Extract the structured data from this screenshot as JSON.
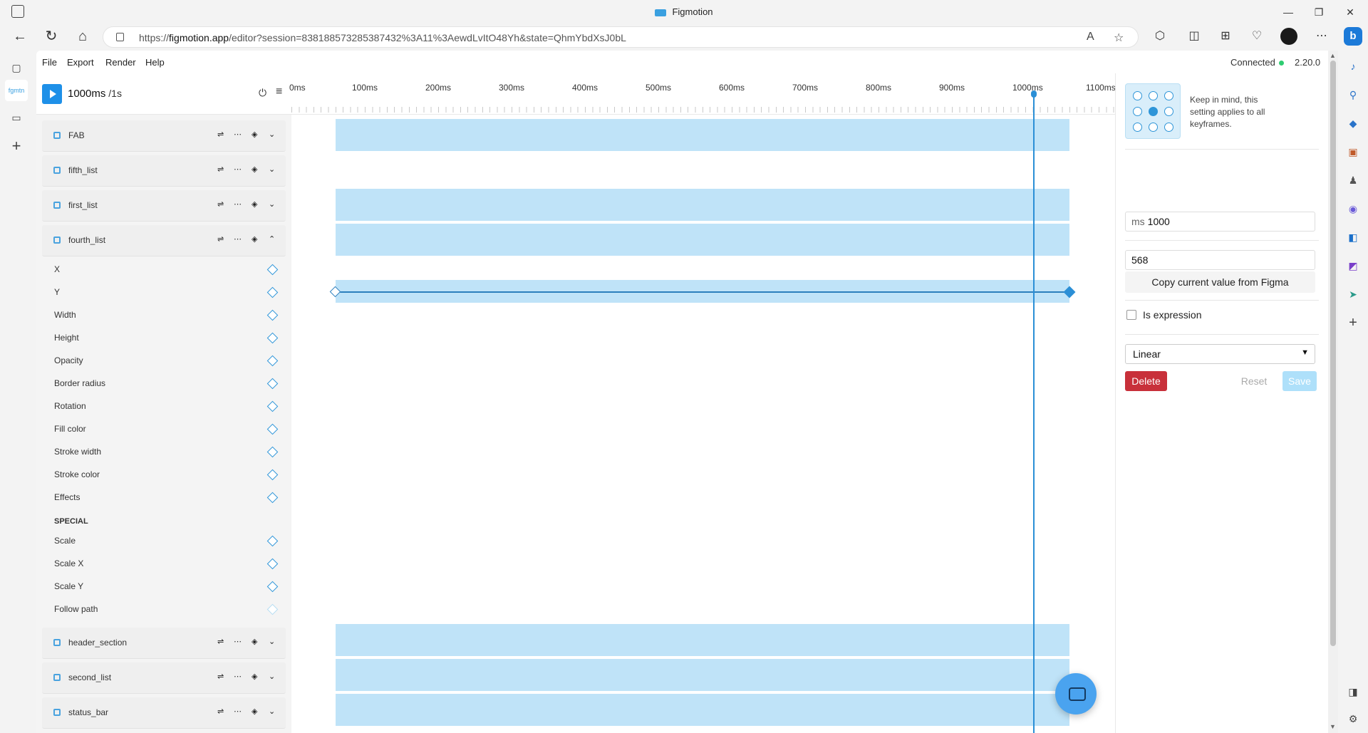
{
  "window": {
    "title": "Figmotion",
    "logo_text": "fgmtn",
    "min": "—",
    "restore": "❐",
    "close": "✕"
  },
  "browser": {
    "url_prefix": "https://",
    "url_host": "figmotion.app",
    "url_rest": "/editor?session=838188573285387432%3A11%3AewdLvItO48Yh&state=QhmYbdXsJ0bL",
    "back": "←",
    "refresh": "↻",
    "home": "⌂",
    "more": "⋯",
    "bing": "b"
  },
  "app": {
    "menu": [
      "File",
      "Export",
      "Render",
      "Help"
    ],
    "status": "Connected",
    "version": "2.20.0",
    "time_current": "1000ms",
    "time_total": " /1s",
    "ruler": [
      "0ms",
      "100ms",
      "200ms",
      "300ms",
      "400ms",
      "500ms",
      "600ms",
      "700ms",
      "800ms",
      "900ms",
      "1000ms",
      "1100ms"
    ],
    "layers_top": [
      "FAB",
      "fifth_list",
      "first_list",
      "fourth_list"
    ],
    "props": [
      "X",
      "Y",
      "Width",
      "Height",
      "Opacity",
      "Border radius",
      "Rotation",
      "Fill color",
      "Stroke width",
      "Stroke color",
      "Effects"
    ],
    "special_label": "SPECIAL",
    "special_props": [
      "Scale",
      "Scale X",
      "Scale Y",
      "Follow path"
    ],
    "layers_bottom": [
      "header_section",
      "second_list",
      "status_bar"
    ],
    "row_icons": {
      "tune": "⇌",
      "more": "⋯",
      "layers": "◈",
      "chev_down": "⌄",
      "chev_up": "⌃"
    }
  },
  "panel": {
    "note": "Keep in mind, this setting applies to all keyframes.",
    "ms_prefix": "ms",
    "ms_value": "1000",
    "value": "568",
    "copy_label": "Copy current value from Figma",
    "is_expression": "Is expression",
    "easing": "Linear",
    "delete": "Delete",
    "reset": "Reset",
    "save": "Save"
  },
  "colors": {
    "accent": "#1e90e8",
    "track": "#bfe3f8",
    "delete": "#c8303a"
  }
}
